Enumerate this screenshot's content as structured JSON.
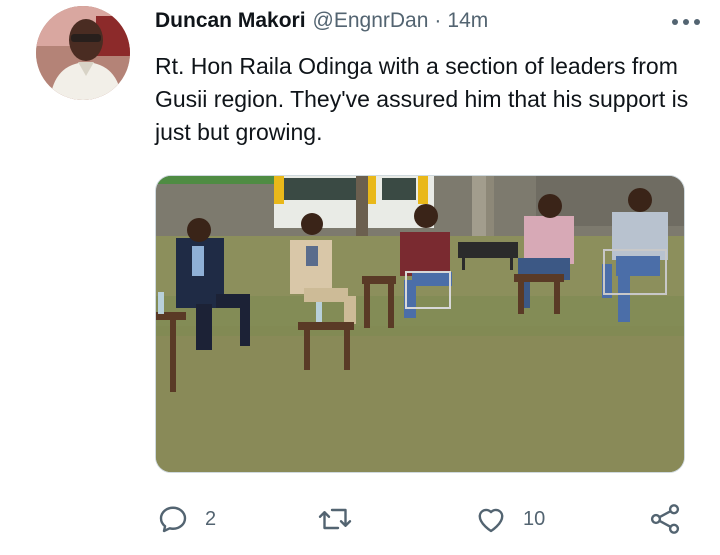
{
  "tweet": {
    "author_name": "Duncan Makori",
    "handle": "@EngnrDan",
    "separator": "·",
    "time": "14m",
    "text": "Rt. Hon Raila Odinga with a section of leaders from Gusii region. They've assured him that his support is just but growing."
  },
  "icons": {
    "more": "more-horizontal-icon",
    "reply": "reply-icon",
    "retweet": "retweet-icon",
    "like": "heart-icon",
    "share": "share-icon"
  },
  "actions": {
    "reply_count": "2",
    "retweet_count": "",
    "like_count": "10"
  },
  "colors": {
    "text": "#0f1419",
    "secondary": "#536471",
    "border": "#cfd9de"
  }
}
